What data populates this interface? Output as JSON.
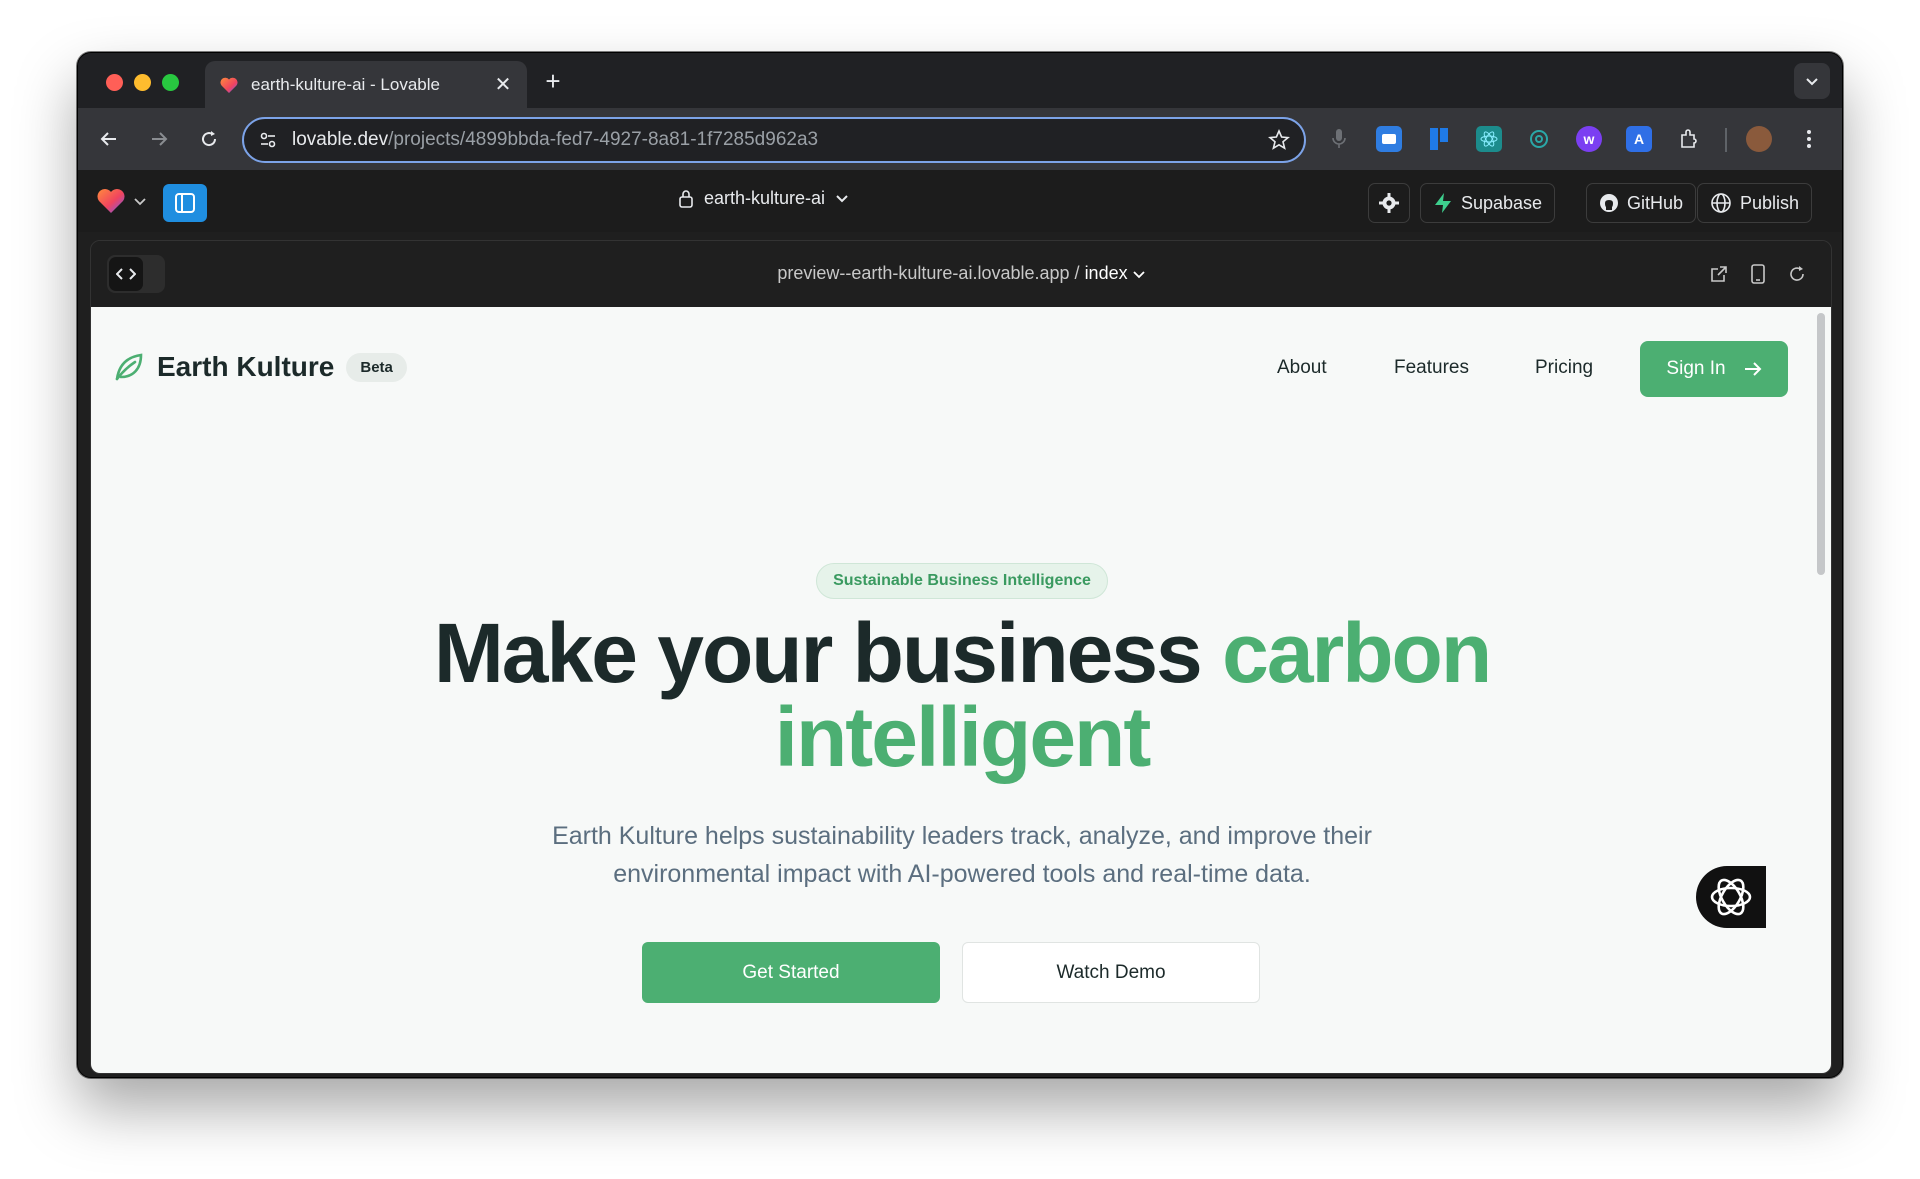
{
  "browser": {
    "tab_title": "earth-kulture-ai - Lovable",
    "url_host": "lovable.dev",
    "url_path": "/projects/4899bbda-fed7-4927-8a81-1f7285d962a3"
  },
  "lovable_bar": {
    "project_name": "earth-kulture-ai",
    "supabase_label": "Supabase",
    "github_label": "GitHub",
    "publish_label": "Publish"
  },
  "preview": {
    "url": "preview--earth-kulture-ai.lovable.app",
    "separator": "/",
    "route": "index"
  },
  "site": {
    "brand_name": "Earth Kulture",
    "beta_badge": "Beta",
    "nav": {
      "about": "About",
      "features": "Features",
      "pricing": "Pricing"
    },
    "signin_label": "Sign In",
    "eyebrow": "Sustainable Business Intelligence",
    "headline_part1": "Make your business",
    "headline_part2": "carbon",
    "headline_part3": "intelligent",
    "subtitle_line1": "Earth Kulture helps sustainability leaders track, analyze, and improve their",
    "subtitle_line2": "environmental impact with AI-powered tools and real-time data.",
    "cta_primary": "Get Started",
    "cta_secondary": "Watch Demo"
  },
  "colors": {
    "accent_green": "#4caf72",
    "dark_text": "#1c2a2a",
    "muted_text": "#5b6e7f"
  }
}
